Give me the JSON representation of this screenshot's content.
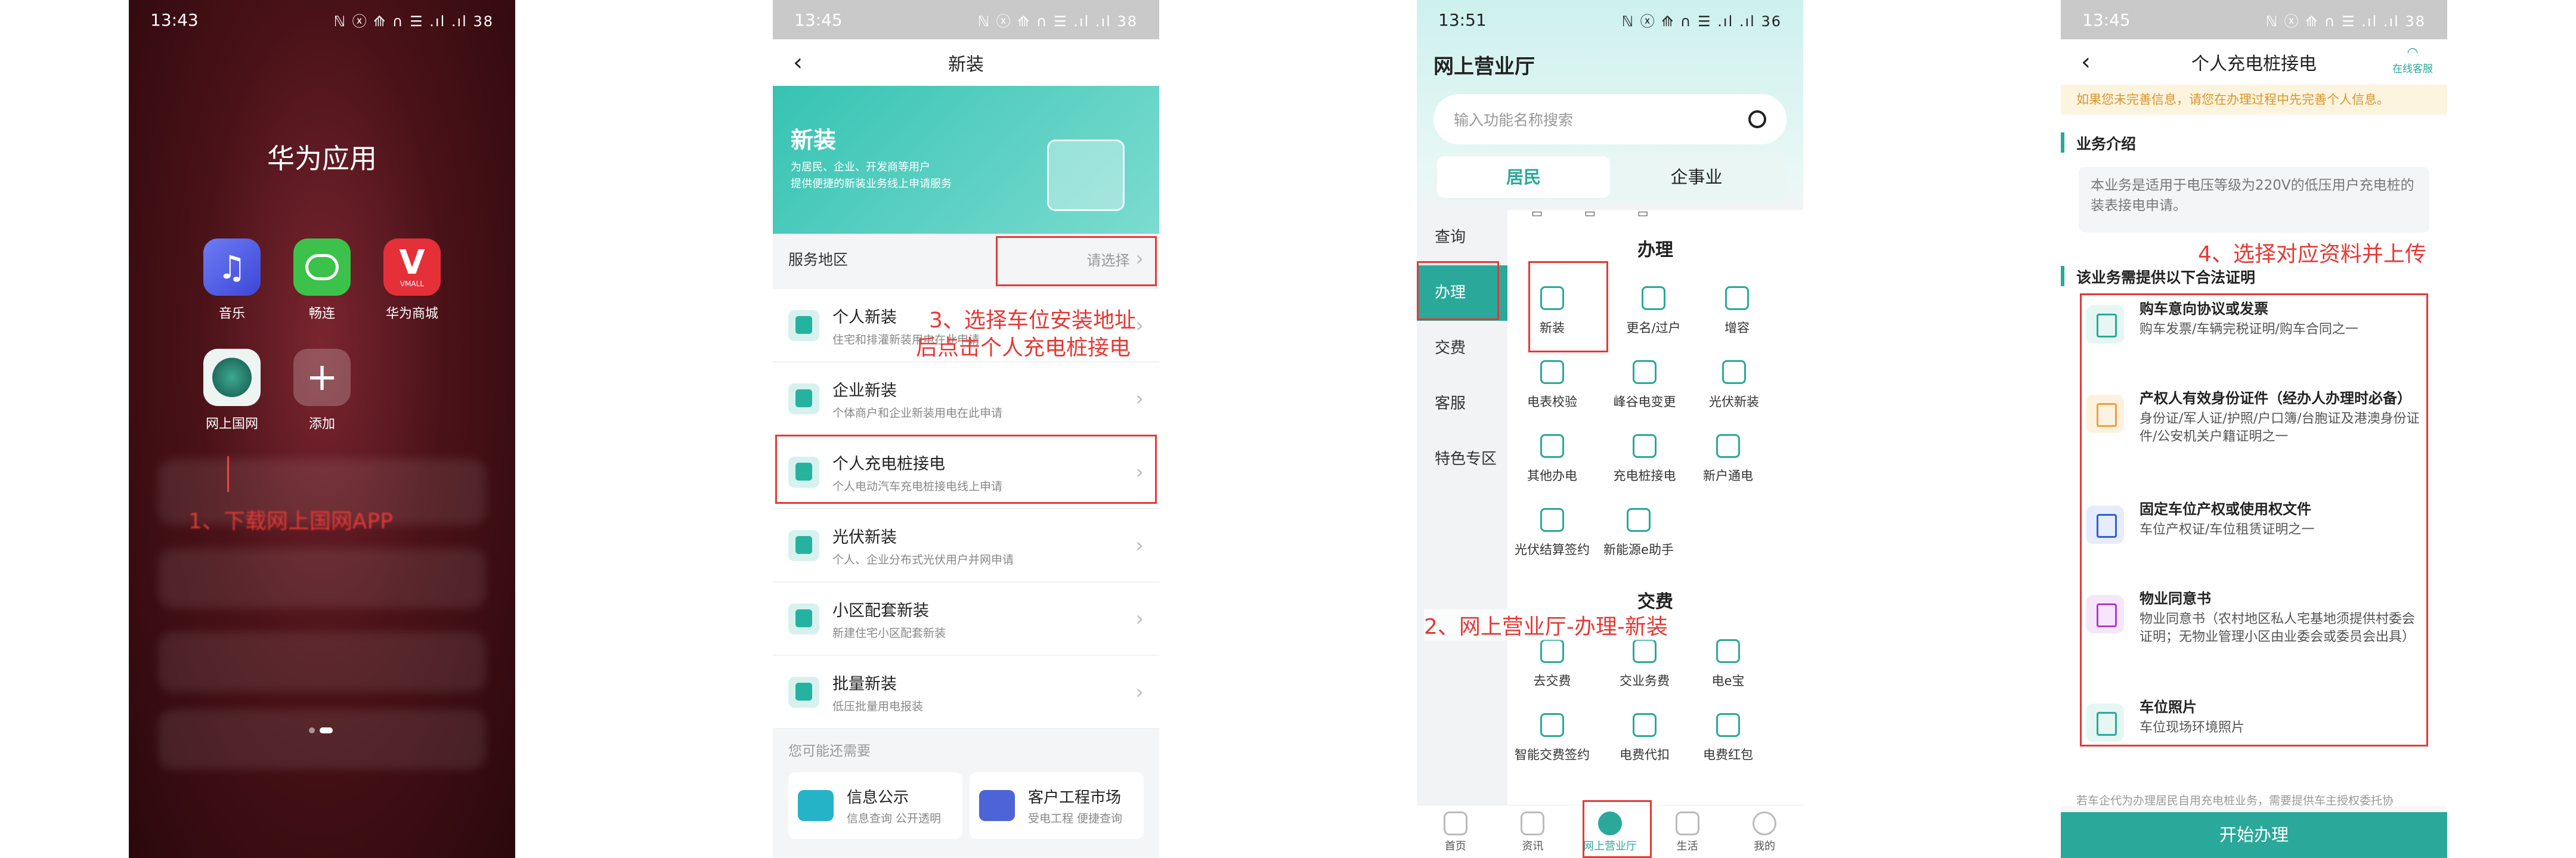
{
  "panel1": {
    "time": "13:43",
    "status_icons": "ℕ ⓧ ⟰ ∩ ☰ .ıl .ıl 38",
    "folder_title": "华为应用",
    "apps": [
      {
        "label": "音乐",
        "icon": "music-icon",
        "color": "#4a5ae8"
      },
      {
        "label": "畅连",
        "icon": "chat-icon",
        "color": "#3cc24a"
      },
      {
        "label": "华为商城",
        "icon": "vmall-icon",
        "color": "#e5303a"
      },
      {
        "label": "网上国网",
        "icon": "state-grid-icon",
        "color": "#2a8a78"
      },
      {
        "label": "添加",
        "icon": "plus-icon",
        "color": "#777777"
      }
    ],
    "vmall_text": "VMALL",
    "annotation": "1、下载网上国网APP"
  },
  "panel2": {
    "time": "13:45",
    "status_icons": "ℕ ⓧ ⟰ ∩ ☰ .ıl .ıl 38",
    "title": "新装",
    "banner_title": "新装",
    "banner_sub1": "为居民、企业、开发商等用户",
    "banner_sub2": "提供便捷的新装业务线上申请服务",
    "service_area_label": "服务地区",
    "service_area_value": "请选择",
    "items": [
      {
        "title": "个人新装",
        "desc": "住宅和排灌新装用电在此申请"
      },
      {
        "title": "企业新装",
        "desc": "个体商户和企业新装用电在此申请"
      },
      {
        "title": "个人充电桩接电",
        "desc": "个人电动汽车充电桩接电线上申请"
      },
      {
        "title": "光伏新装",
        "desc": "个人、企业分布式光伏用户并网申请"
      },
      {
        "title": "小区配套新装",
        "desc": "新建住宅小区配套新装"
      },
      {
        "title": "批量新装",
        "desc": "低压批量用电报装"
      }
    ],
    "annotation_line1": "3、选择车位安装地址",
    "annotation_line2": "后点击个人充电桩接电",
    "maybe_title": "您可能还需要",
    "cards": [
      {
        "title": "信息公示",
        "desc": "信息查询 公开透明"
      },
      {
        "title": "客户工程市场",
        "desc": "受电工程 便捷查询"
      }
    ]
  },
  "panel3": {
    "time": "13:51",
    "status_icons": "ℕ ⓧ ⟰ ∩ ☰ .ıl .ıl 36",
    "title": "网上营业厅",
    "search_placeholder": "输入功能名称搜索",
    "tabs": [
      "居民",
      "企事业"
    ],
    "left_nav": [
      "查询",
      "办理",
      "交费",
      "客服",
      "特色专区"
    ],
    "section_handle": "办理",
    "handle_items": [
      "新装",
      "更名/过户",
      "增容",
      "电表校验",
      "峰谷电变更",
      "光伏新装",
      "其他办电",
      "充电桩接电",
      "新户通电",
      "光伏结算签约",
      "新能源e助手"
    ],
    "section_pay": "交费",
    "pay_items": [
      "去交费",
      "交业务费",
      "电e宝",
      "智能交费签约",
      "电费代扣",
      "电费红包"
    ],
    "annotation": "2、网上营业厅-办理-新装",
    "bottom_nav": [
      "首页",
      "资讯",
      "网上营业厅",
      "生活",
      "我的"
    ]
  },
  "panel4": {
    "time": "13:45",
    "status_icons": "ℕ ⓧ ⟰ ∩ ☰ .ıl .ıl 38",
    "title": "个人充电桩接电",
    "online_service": "在线客服",
    "notice": "如果您未完善信息，请您在办理过程中先完善个人信息。",
    "intro_title": "业务介绍",
    "intro_text": "本业务是适用于电压等级为220V的低压用户充电桩的装表接电申请。",
    "annotation": "4、选择对应资料并上传",
    "docs_title": "该业务需提供以下合法证明",
    "docs": [
      {
        "title": "购车意向协议或发票",
        "desc": "购车发票/车辆完税证明/购车合同之一",
        "color": "#2aa99a"
      },
      {
        "title": "产权人有效身份证件（经办人办理时必备）",
        "desc": "身份证/军人证/护照/户口簿/台胞证及港澳身份证件/公安机关户籍证明之一",
        "color": "#e8a33a"
      },
      {
        "title": "固定车位产权或使用权文件",
        "desc": "车位产权证/车位租赁证明之一",
        "color": "#2f5fd0"
      },
      {
        "title": "物业同意书",
        "desc": "物业同意书（农村地区私人宅基地须提供村委会证明；无物业管理小区由业委会或委员会出具）",
        "color": "#b03ad0"
      },
      {
        "title": "车位照片",
        "desc": "车位现场环境照片",
        "color": "#2aa99a"
      }
    ],
    "footer_note": "若车企代为办理居民自用充电桩业务，需要提供车主授权委托协",
    "start_button": "开始办理"
  }
}
